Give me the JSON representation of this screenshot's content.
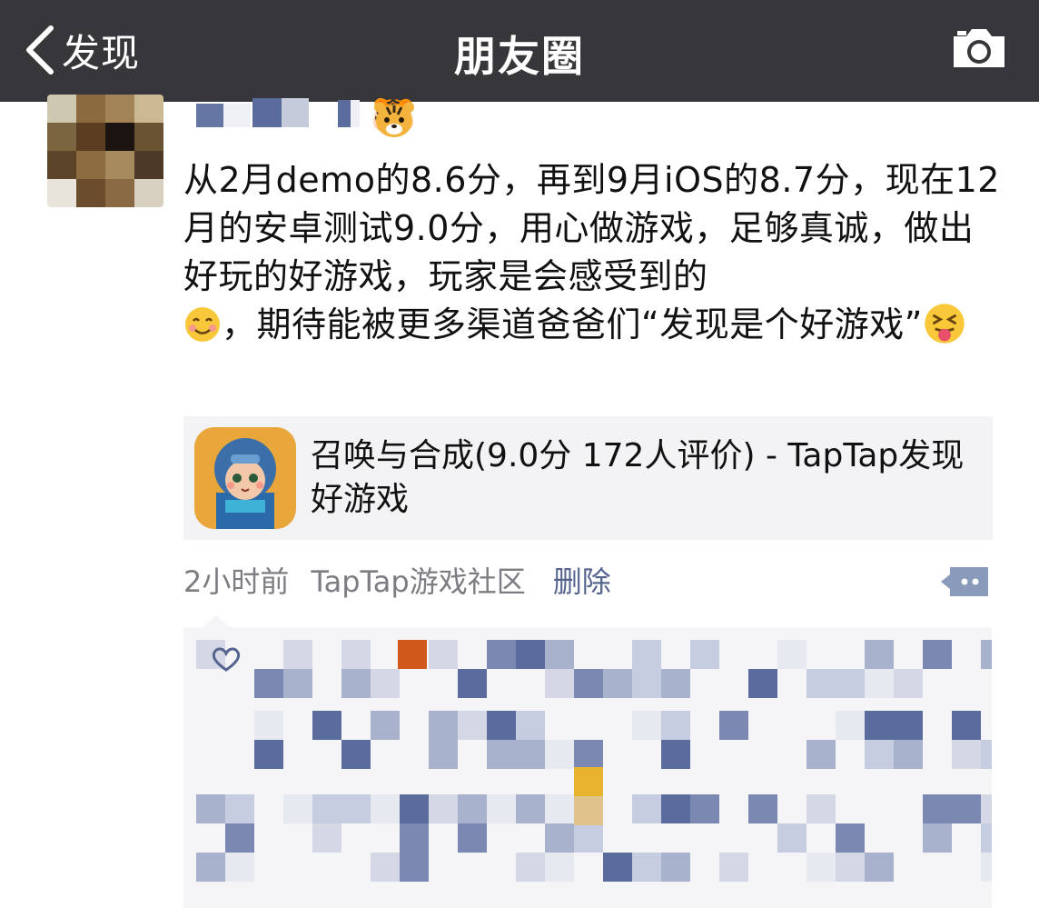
{
  "navbar": {
    "back_label": "发现",
    "title": "朋友圈"
  },
  "post": {
    "text_before_emoji": "从2月demo的8.6分，再到9月iOS的8.7分，现在12月的安卓测试9.0分，用心做游戏，足够真诚，做出好玩的好游戏，玩家是会感受到的",
    "text_middle": "，期待能被更多渠道爸爸们“发现是个好游戏”",
    "emoji_smile": "smiling-face-icon",
    "emoji_tongue": "squinting-tongue-face-icon",
    "nickname_emoji": "🐯"
  },
  "link_card": {
    "title": "召唤与合成(9.0分 172人评价) - TapTap发现好游戏",
    "icon": "game-character-icon"
  },
  "meta": {
    "time": "2小时前",
    "source": "TapTap游戏社区",
    "delete_label": "删除"
  },
  "colors": {
    "navbar": "#37373b",
    "link_blue": "#55648e",
    "meta_gray": "#7c7c82",
    "card_bg": "#f3f3f5"
  }
}
